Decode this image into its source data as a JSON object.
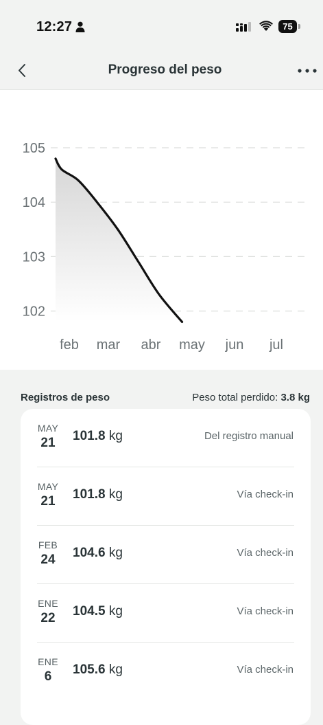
{
  "status_bar": {
    "time": "12:27",
    "battery": "75"
  },
  "header": {
    "title": "Progreso del peso"
  },
  "chart_data": {
    "type": "area",
    "x_ticks": [
      "feb",
      "mar",
      "abr",
      "may",
      "jun",
      "jul"
    ],
    "y_ticks": [
      102,
      103,
      104,
      105
    ],
    "ylim": [
      101.6,
      105.3
    ],
    "grid": true,
    "series": [
      {
        "points": [
          {
            "x": 0.0,
            "y": 104.8
          },
          {
            "x": 0.15,
            "y": 104.6
          },
          {
            "x": 0.55,
            "y": 104.4
          },
          {
            "x": 1.0,
            "y": 104.0
          },
          {
            "x": 1.5,
            "y": 103.5
          },
          {
            "x": 2.0,
            "y": 102.9
          },
          {
            "x": 2.5,
            "y": 102.3
          },
          {
            "x": 3.05,
            "y": 101.8
          }
        ]
      }
    ],
    "colors": {
      "line": "#111111",
      "grid": "#dcdedc",
      "tick": "#6b7275"
    }
  },
  "records": {
    "title": "Registros de peso",
    "total_label": "Peso total perdido:",
    "total_value": "3.8 kg",
    "unit": "kg",
    "items": [
      {
        "month": "MAY",
        "day": "21",
        "weight": "101.8",
        "source": "Del registro manual"
      },
      {
        "month": "MAY",
        "day": "21",
        "weight": "101.8",
        "source": "Vía check-in"
      },
      {
        "month": "FEB",
        "day": "24",
        "weight": "104.6",
        "source": "Vía check-in"
      },
      {
        "month": "ENE",
        "day": "22",
        "weight": "104.5",
        "source": "Vía check-in"
      },
      {
        "month": "ENE",
        "day": "6",
        "weight": "105.6",
        "source": "Vía check-in"
      }
    ]
  }
}
